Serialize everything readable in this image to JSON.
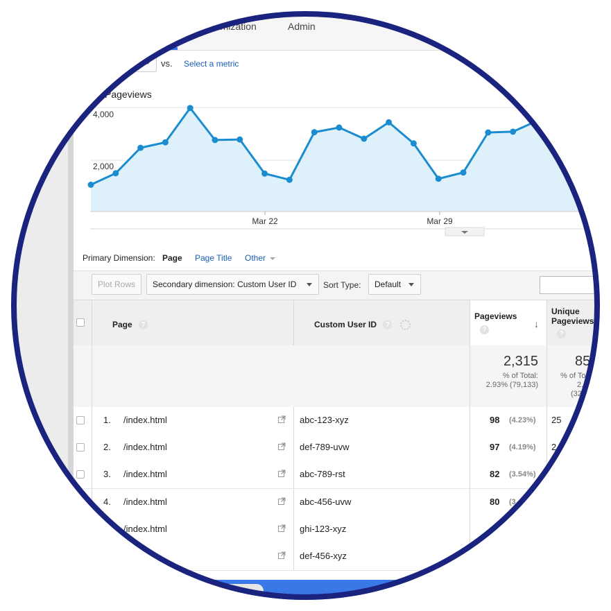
{
  "nav": {
    "items": [
      "Customization",
      "Admin"
    ],
    "partial_first": "tomization"
  },
  "metric_bar": {
    "vs_label": "vs.",
    "select_metric_link": "Select a metric"
  },
  "chart_data": {
    "type": "area",
    "title": "Pageviews",
    "y_ticks": [
      "4,000",
      "2,000"
    ],
    "x_ticks": [
      "Mar 22",
      "Mar 29"
    ],
    "ylim": [
      0,
      4000
    ],
    "grid": true,
    "colors": {
      "line": "#1a8ccf",
      "fill": "#def0f9"
    },
    "series": [
      {
        "values": [
          1030,
          1470,
          2450,
          2660,
          3980,
          2750,
          2770,
          1460,
          1220,
          3050,
          3230,
          2800,
          3430,
          2620,
          1260,
          1500,
          3040,
          3070,
          3500
        ]
      }
    ]
  },
  "primary_dimension": {
    "label": "Primary Dimension:",
    "options": [
      "Page",
      "Page Title",
      "Other"
    ],
    "active": "Page"
  },
  "toolbar": {
    "plot_rows": "Plot Rows",
    "secondary_dimension": "Secondary dimension: Custom User ID",
    "sort_type_label": "Sort Type:",
    "sort_type_value": "Default"
  },
  "table": {
    "headers": {
      "page": "Page",
      "custom_user_id": "Custom User ID",
      "pageviews": "Pageviews",
      "unique_pageviews_1": "Unique",
      "unique_pageviews_2": "Pageviews"
    },
    "help_glyph": "?",
    "totals": {
      "pageviews": "2,315",
      "pageviews_pct_label": "% of Total:",
      "pageviews_pct": "2.93% (79,133)",
      "unique_partial": "85",
      "unique_pct_label_partial": "% of To",
      "unique_pct_partial": "2.",
      "unique_total_partial": "(32"
    },
    "rows": [
      {
        "rank": "1.",
        "page": "/index.html",
        "user_id": "abc-123-xyz",
        "pageviews": "98",
        "pct": "(4.23%)",
        "unique": "25"
      },
      {
        "rank": "2.",
        "page": "/index.html",
        "user_id": "def-789-uvw",
        "pageviews": "97",
        "pct": "(4.19%)",
        "unique": "2"
      },
      {
        "rank": "3.",
        "page": "/index.html",
        "user_id": "abc-789-rst",
        "pageviews": "82",
        "pct": "(3.54%)",
        "unique": ""
      },
      {
        "rank": "4.",
        "page": "/index.html",
        "user_id": "abc-456-uvw",
        "pageviews": "80",
        "pct": "(3.",
        "unique": ""
      },
      {
        "rank": "",
        "page": "/index.html",
        "user_id": "ghi-123-xyz",
        "pageviews": "",
        "pct": "",
        "unique": ""
      },
      {
        "rank": "",
        "page": "html",
        "user_id": "def-456-xyz",
        "pageviews": "",
        "pct": "",
        "unique": ""
      }
    ]
  }
}
